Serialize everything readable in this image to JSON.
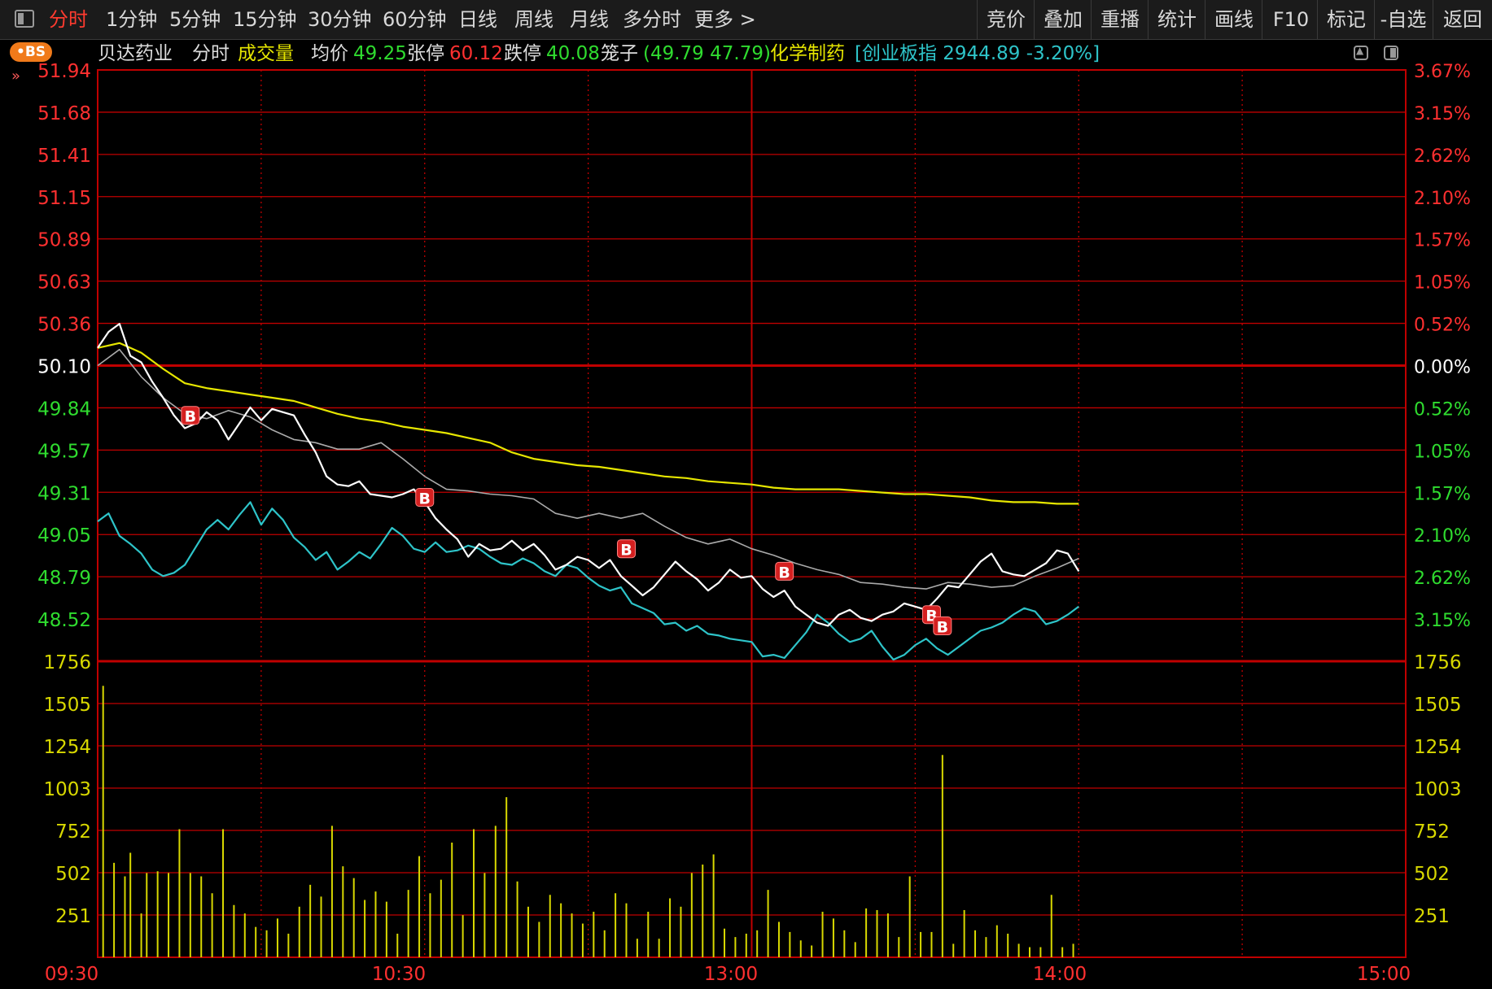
{
  "toolbar": {
    "tabs": [
      {
        "label": "分时",
        "active": true
      },
      {
        "label": "1分钟"
      },
      {
        "label": "5分钟"
      },
      {
        "label": "15分钟"
      },
      {
        "label": "30分钟"
      },
      {
        "label": "60分钟"
      },
      {
        "label": "日线"
      },
      {
        "label": "周线"
      },
      {
        "label": "月线"
      },
      {
        "label": "多分时"
      },
      {
        "label": "更多 >"
      }
    ],
    "right_buttons": [
      "竞价",
      "叠加",
      "重播",
      "统计",
      "画线",
      "F10",
      "标记",
      "-自选",
      "返回"
    ]
  },
  "info": {
    "badge": "•BS",
    "stock_name": "贝达药业",
    "mode": "分时",
    "volume_label": "成交量",
    "avg_label": "均价",
    "avg_value": "49.25",
    "limit_up_label": "张停",
    "limit_up_value": "60.12",
    "limit_down_label": "跌停",
    "limit_down_value": "40.08",
    "cage_label": "笼子",
    "cage_value": "(49.79 47.79)",
    "sector": "化学制药",
    "index_info": "[创业板指 2944.89 -3.20%]"
  },
  "colors": {
    "grid": "#c00000",
    "price": "#ffffff",
    "avg": "#e6e600",
    "index": "#2ec4c9",
    "sector": "#aaaaaa",
    "up": "#ff3030",
    "down": "#2fdc2f",
    "volume": "#d8d800",
    "marker": "#d42020"
  },
  "chart_data": {
    "type": "line",
    "session": "intraday",
    "prev_close": 50.1,
    "price_ticks": [
      "51.94",
      "51.68",
      "51.41",
      "51.15",
      "50.89",
      "50.63",
      "50.36",
      "50.10",
      "49.84",
      "49.57",
      "49.31",
      "49.05",
      "48.79",
      "48.52"
    ],
    "pct_ticks": [
      "3.67%",
      "3.15%",
      "2.62%",
      "2.10%",
      "1.57%",
      "1.05%",
      "0.52%",
      "0.00%",
      "0.52%",
      "1.05%",
      "1.57%",
      "2.10%",
      "2.62%",
      "3.15%"
    ],
    "price_range": [
      48.26,
      51.94
    ],
    "volume_ticks": [
      "1756",
      "1505",
      "1254",
      "1003",
      "752",
      "502",
      "251"
    ],
    "volume_range": [
      0,
      1756
    ],
    "time_labels": [
      "09:30",
      "10:30",
      "13:00",
      "14:00",
      "15:00"
    ],
    "total_minutes": 240,
    "series": [
      {
        "name": "price",
        "color_key": "price",
        "x": [
          0,
          2,
          4,
          6,
          8,
          10,
          12,
          14,
          16,
          18,
          20,
          22,
          24,
          26,
          28,
          30,
          32,
          34,
          36,
          38,
          40,
          42,
          44,
          46,
          48,
          50,
          52,
          54,
          56,
          58,
          60,
          62,
          64,
          66,
          68,
          70,
          72,
          74,
          76,
          78,
          80,
          82,
          84,
          86,
          88,
          90,
          92,
          94,
          96,
          98,
          100,
          102,
          104,
          106,
          108,
          110,
          112,
          114,
          116,
          118,
          120,
          122,
          124,
          126,
          128,
          130,
          132,
          134,
          136,
          138,
          140,
          142,
          144,
          146,
          148,
          150,
          152,
          154,
          156,
          158,
          160,
          162,
          164,
          166,
          168,
          170,
          172,
          174,
          176,
          178,
          180
        ],
        "values": [
          50.21,
          50.31,
          50.36,
          50.16,
          50.12,
          50.0,
          49.9,
          49.79,
          49.71,
          49.74,
          49.81,
          49.76,
          49.64,
          49.74,
          49.84,
          49.76,
          49.83,
          49.81,
          49.79,
          49.67,
          49.56,
          49.41,
          49.36,
          49.35,
          49.38,
          49.3,
          49.29,
          49.28,
          49.3,
          49.33,
          49.25,
          49.15,
          49.08,
          49.02,
          48.91,
          48.99,
          48.95,
          48.96,
          49.01,
          48.95,
          48.99,
          48.92,
          48.83,
          48.86,
          48.91,
          48.89,
          48.84,
          48.89,
          48.79,
          48.73,
          48.67,
          48.72,
          48.8,
          48.88,
          48.82,
          48.77,
          48.7,
          48.75,
          48.83,
          48.78,
          48.79,
          48.71,
          48.66,
          48.7,
          48.6,
          48.55,
          48.5,
          48.48,
          48.55,
          48.58,
          48.53,
          48.51,
          48.55,
          48.57,
          48.62,
          48.6,
          48.58,
          48.65,
          48.73,
          48.72,
          48.8,
          48.88,
          48.93,
          48.82,
          48.8,
          48.79,
          48.83,
          48.87,
          48.95,
          48.93,
          48.82
        ]
      },
      {
        "name": "avg",
        "color_key": "avg",
        "x": [
          0,
          4,
          8,
          12,
          16,
          20,
          24,
          28,
          32,
          36,
          40,
          44,
          48,
          52,
          56,
          60,
          64,
          68,
          72,
          76,
          80,
          84,
          88,
          92,
          96,
          100,
          104,
          108,
          112,
          116,
          120,
          124,
          128,
          132,
          136,
          140,
          144,
          148,
          152,
          156,
          160,
          164,
          168,
          172,
          176,
          180
        ],
        "values": [
          50.21,
          50.24,
          50.18,
          50.08,
          49.99,
          49.96,
          49.94,
          49.92,
          49.9,
          49.88,
          49.84,
          49.8,
          49.77,
          49.75,
          49.72,
          49.7,
          49.68,
          49.65,
          49.62,
          49.56,
          49.52,
          49.5,
          49.48,
          49.47,
          49.45,
          49.43,
          49.41,
          49.4,
          49.38,
          49.37,
          49.36,
          49.34,
          49.33,
          49.33,
          49.33,
          49.32,
          49.31,
          49.3,
          49.3,
          49.29,
          49.28,
          49.26,
          49.25,
          49.25,
          49.24,
          49.24
        ]
      },
      {
        "name": "sector",
        "color_key": "sector",
        "x": [
          0,
          4,
          8,
          12,
          16,
          20,
          24,
          28,
          32,
          36,
          40,
          44,
          48,
          52,
          56,
          60,
          64,
          68,
          72,
          76,
          80,
          84,
          88,
          92,
          96,
          100,
          104,
          108,
          112,
          116,
          120,
          124,
          128,
          132,
          136,
          140,
          144,
          148,
          152,
          156,
          160,
          164,
          168,
          172,
          176,
          180
        ],
        "values": [
          50.1,
          50.2,
          50.03,
          49.9,
          49.8,
          49.77,
          49.82,
          49.78,
          49.7,
          49.64,
          49.62,
          49.58,
          49.58,
          49.62,
          49.52,
          49.41,
          49.33,
          49.32,
          49.3,
          49.29,
          49.27,
          49.18,
          49.15,
          49.18,
          49.15,
          49.18,
          49.1,
          49.03,
          48.99,
          49.02,
          48.96,
          48.92,
          48.87,
          48.83,
          48.8,
          48.75,
          48.74,
          48.72,
          48.71,
          48.75,
          48.74,
          48.72,
          48.73,
          48.79,
          48.84,
          48.9
        ]
      },
      {
        "name": "index",
        "color_key": "index",
        "x": [
          0,
          2,
          4,
          6,
          8,
          10,
          12,
          14,
          16,
          18,
          20,
          22,
          24,
          26,
          28,
          30,
          32,
          34,
          36,
          38,
          40,
          42,
          44,
          46,
          48,
          50,
          52,
          54,
          56,
          58,
          60,
          62,
          64,
          66,
          68,
          70,
          72,
          74,
          76,
          78,
          80,
          82,
          84,
          86,
          88,
          90,
          92,
          94,
          96,
          98,
          100,
          102,
          104,
          106,
          108,
          110,
          112,
          114,
          116,
          118,
          120,
          122,
          124,
          126,
          128,
          130,
          132,
          134,
          136,
          138,
          140,
          142,
          144,
          146,
          148,
          150,
          152,
          154,
          156,
          158,
          160,
          162,
          164,
          166,
          168,
          170,
          172,
          174,
          176,
          178,
          180
        ],
        "values": [
          49.13,
          49.18,
          49.04,
          48.99,
          48.93,
          48.83,
          48.79,
          48.81,
          48.86,
          48.97,
          49.08,
          49.14,
          49.08,
          49.17,
          49.25,
          49.11,
          49.21,
          49.14,
          49.03,
          48.97,
          48.89,
          48.94,
          48.83,
          48.88,
          48.94,
          48.9,
          48.99,
          49.09,
          49.04,
          48.96,
          48.94,
          49.0,
          48.94,
          48.95,
          48.98,
          48.96,
          48.91,
          48.87,
          48.86,
          48.9,
          48.87,
          48.82,
          48.79,
          48.86,
          48.84,
          48.78,
          48.73,
          48.7,
          48.72,
          48.62,
          48.59,
          48.56,
          48.49,
          48.5,
          48.45,
          48.48,
          48.43,
          48.42,
          48.4,
          48.39,
          48.38,
          48.29,
          48.3,
          48.28,
          48.36,
          48.44,
          48.55,
          48.5,
          48.43,
          48.38,
          48.4,
          48.45,
          48.35,
          48.27,
          48.3,
          48.36,
          48.4,
          48.34,
          48.3,
          48.35,
          48.4,
          48.45,
          48.47,
          48.5,
          48.55,
          48.59,
          48.57,
          48.49,
          48.51,
          48.55,
          48.6
        ]
      }
    ],
    "volume": {
      "x": [
        1,
        3,
        5,
        6,
        8,
        9,
        11,
        13,
        15,
        17,
        19,
        21,
        23,
        25,
        27,
        29,
        31,
        33,
        35,
        37,
        39,
        41,
        43,
        45,
        47,
        49,
        51,
        53,
        55,
        57,
        59,
        61,
        63,
        65,
        67,
        69,
        71,
        73,
        75,
        77,
        79,
        81,
        83,
        85,
        87,
        89,
        91,
        93,
        95,
        97,
        99,
        101,
        103,
        105,
        107,
        109,
        111,
        113,
        115,
        117,
        119,
        121,
        123,
        125,
        127,
        129,
        131,
        133,
        135,
        137,
        139,
        141,
        143,
        145,
        147,
        149,
        151,
        153,
        155,
        157,
        159,
        161,
        163,
        165,
        167,
        169,
        171,
        173,
        175,
        177,
        179
      ],
      "values": [
        1610,
        560,
        480,
        620,
        260,
        500,
        510,
        500,
        760,
        500,
        480,
        380,
        760,
        310,
        260,
        180,
        160,
        230,
        140,
        300,
        430,
        360,
        780,
        540,
        470,
        340,
        390,
        330,
        140,
        400,
        600,
        380,
        460,
        680,
        250,
        760,
        500,
        780,
        950,
        450,
        300,
        210,
        370,
        320,
        260,
        200,
        270,
        160,
        380,
        320,
        110,
        270,
        110,
        350,
        300,
        500,
        550,
        610,
        170,
        120,
        140,
        160,
        400,
        210,
        150,
        100,
        70,
        270,
        230,
        160,
        90,
        290,
        280,
        260,
        120,
        480,
        150,
        150,
        1200,
        80,
        280,
        160,
        120,
        190,
        140,
        80,
        60,
        60,
        370,
        60,
        80,
        130
      ]
    },
    "markers": [
      {
        "label": "B",
        "x": 17,
        "y": 49.79
      },
      {
        "label": "B",
        "x": 60,
        "y": 49.28
      },
      {
        "label": "B",
        "x": 97,
        "y": 48.96
      },
      {
        "label": "B",
        "x": 126,
        "y": 48.82
      },
      {
        "label": "B",
        "x": 153,
        "y": 48.55
      },
      {
        "label": "B",
        "x": 155,
        "y": 48.48
      }
    ]
  }
}
